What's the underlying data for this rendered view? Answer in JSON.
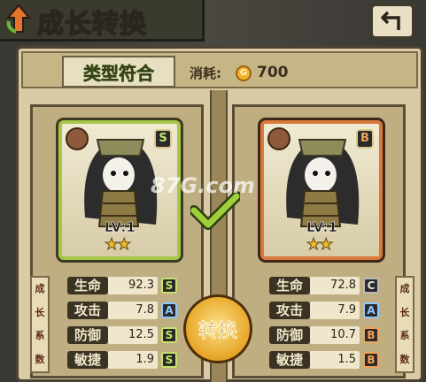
{
  "title": "成长转换",
  "type_badge": "类型符合",
  "cost": {
    "label": "消耗:",
    "coin_symbol": "G",
    "value": "700"
  },
  "watermark": "87G.com",
  "left_card": {
    "rank": "S",
    "level": "LV:1",
    "stars": "★★"
  },
  "right_card": {
    "rank": "B",
    "level": "LV:1",
    "stars": "★★"
  },
  "growth_label": [
    "成",
    "·",
    "长",
    "·",
    "系",
    "·",
    "数"
  ],
  "left_stats": [
    {
      "name": "生命",
      "value": "92.3",
      "grade": "S"
    },
    {
      "name": "攻击",
      "value": "7.8",
      "grade": "A"
    },
    {
      "name": "防御",
      "value": "12.5",
      "grade": "S"
    },
    {
      "name": "敏捷",
      "value": "1.9",
      "grade": "S"
    }
  ],
  "right_stats": [
    {
      "name": "生命",
      "value": "72.8",
      "grade": "C"
    },
    {
      "name": "攻击",
      "value": "7.9",
      "grade": "A"
    },
    {
      "name": "防御",
      "value": "10.7",
      "grade": "B"
    },
    {
      "name": "敏捷",
      "value": "1.5",
      "grade": "B"
    }
  ],
  "convert_button": "转换",
  "icons": {
    "back": "back-arrow-icon",
    "check": "check-icon",
    "class": "class-icon",
    "coin": "coin-icon"
  },
  "colors": {
    "left_frame": "#a7c64a",
    "right_frame": "#d9793b",
    "type_text": "#5a7a24"
  }
}
